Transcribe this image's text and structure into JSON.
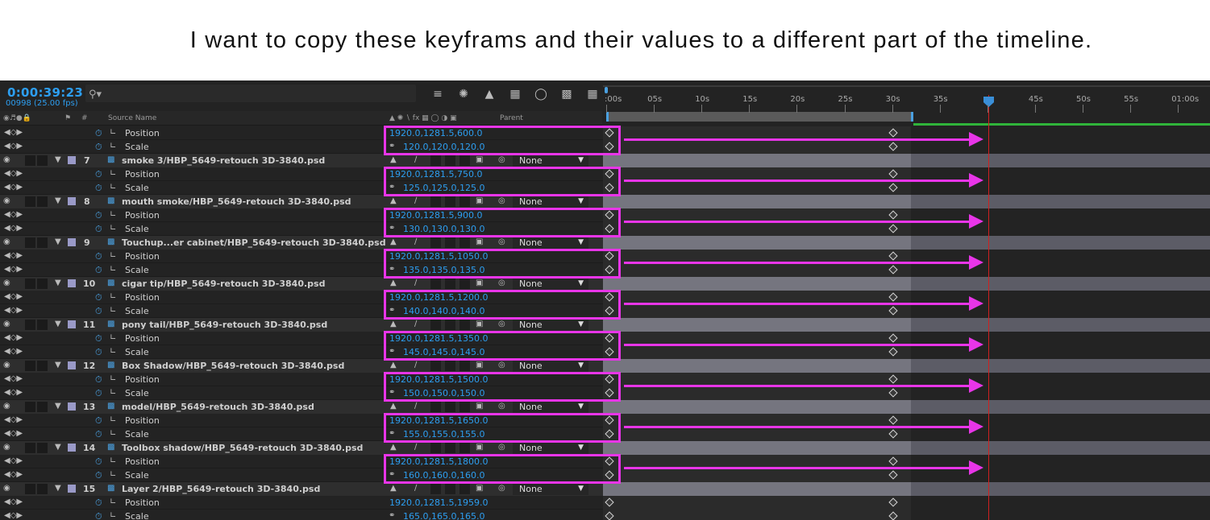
{
  "caption": "I want to copy these keyframs and their values to a different part of the timeline.",
  "header": {
    "timecode": "0:00:39:23",
    "frame_fps": "00998 (25.00 fps)",
    "search_placeholder": "",
    "tool_icons": [
      "comp-mini-flowchart-icon",
      "draft-3d-icon",
      "shy-layers-icon",
      "frame-blending-icon",
      "motion-blur-icon",
      "graph-editor-icon",
      "brainstorm-icon"
    ]
  },
  "columns": {
    "hash": "#",
    "source_name": "Source Name",
    "parent": "Parent"
  },
  "ruler": {
    "ticks": [
      ":00s",
      "05s",
      "10s",
      "15s",
      "20s",
      "25s",
      "30s",
      "35s",
      "",
      "45s",
      "50s",
      "55s",
      "01:00s"
    ]
  },
  "parent_none": "None",
  "rows": [
    {
      "type": "prop",
      "name": "Position",
      "value": "1920.0,1281.5,600.0"
    },
    {
      "type": "prop",
      "name": "Scale",
      "value": "120.0,120.0,120.0",
      "link": true
    },
    {
      "type": "layer",
      "num": "7",
      "name": "smoke 3/HBP_5649-retouch 3D-3840.psd"
    },
    {
      "type": "prop",
      "name": "Position",
      "value": "1920.0,1281.5,750.0"
    },
    {
      "type": "prop",
      "name": "Scale",
      "value": "125.0,125.0,125.0",
      "link": true
    },
    {
      "type": "layer",
      "num": "8",
      "name": "mouth smoke/HBP_5649-retouch 3D-3840.psd"
    },
    {
      "type": "prop",
      "name": "Position",
      "value": "1920.0,1281.5,900.0"
    },
    {
      "type": "prop",
      "name": "Scale",
      "value": "130.0,130.0,130.0",
      "link": true
    },
    {
      "type": "layer",
      "num": "9",
      "name": "Touchup...er cabinet/HBP_5649-retouch 3D-3840.psd"
    },
    {
      "type": "prop",
      "name": "Position",
      "value": "1920.0,1281.5,1050.0"
    },
    {
      "type": "prop",
      "name": "Scale",
      "value": "135.0,135.0,135.0",
      "link": true
    },
    {
      "type": "layer",
      "num": "10",
      "name": "cigar tip/HBP_5649-retouch 3D-3840.psd"
    },
    {
      "type": "prop",
      "name": "Position",
      "value": "1920.0,1281.5,1200.0"
    },
    {
      "type": "prop",
      "name": "Scale",
      "value": "140.0,140.0,140.0",
      "link": true
    },
    {
      "type": "layer",
      "num": "11",
      "name": "pony tail/HBP_5649-retouch 3D-3840.psd"
    },
    {
      "type": "prop",
      "name": "Position",
      "value": "1920.0,1281.5,1350.0"
    },
    {
      "type": "prop",
      "name": "Scale",
      "value": "145.0,145.0,145.0",
      "link": true
    },
    {
      "type": "layer",
      "num": "12",
      "name": "Box Shadow/HBP_5649-retouch 3D-3840.psd"
    },
    {
      "type": "prop",
      "name": "Position",
      "value": "1920.0,1281.5,1500.0"
    },
    {
      "type": "prop",
      "name": "Scale",
      "value": "150.0,150.0,150.0",
      "link": true
    },
    {
      "type": "layer",
      "num": "13",
      "name": "model/HBP_5649-retouch 3D-3840.psd"
    },
    {
      "type": "prop",
      "name": "Position",
      "value": "1920.0,1281.5,1650.0"
    },
    {
      "type": "prop",
      "name": "Scale",
      "value": "155.0,155.0,155.0",
      "link": true
    },
    {
      "type": "layer",
      "num": "14",
      "name": "Toolbox shadow/HBP_5649-retouch 3D-3840.psd"
    },
    {
      "type": "prop",
      "name": "Position",
      "value": "1920.0,1281.5,1800.0"
    },
    {
      "type": "prop",
      "name": "Scale",
      "value": "160.0,160.0,160.0",
      "link": true
    },
    {
      "type": "layer",
      "num": "15",
      "name": "Layer 2/HBP_5649-retouch 3D-3840.psd"
    },
    {
      "type": "prop",
      "name": "Position",
      "value": "1920.0,1281.5,1959.0"
    },
    {
      "type": "prop",
      "name": "Scale",
      "value": "165.0,165.0,165.0",
      "link": true
    }
  ],
  "colors": {
    "accent_blue": "#2d9ef0",
    "annotation_magenta": "#e835e8",
    "playhead_red": "#d02020",
    "work_area_green": "#2fb43a"
  }
}
